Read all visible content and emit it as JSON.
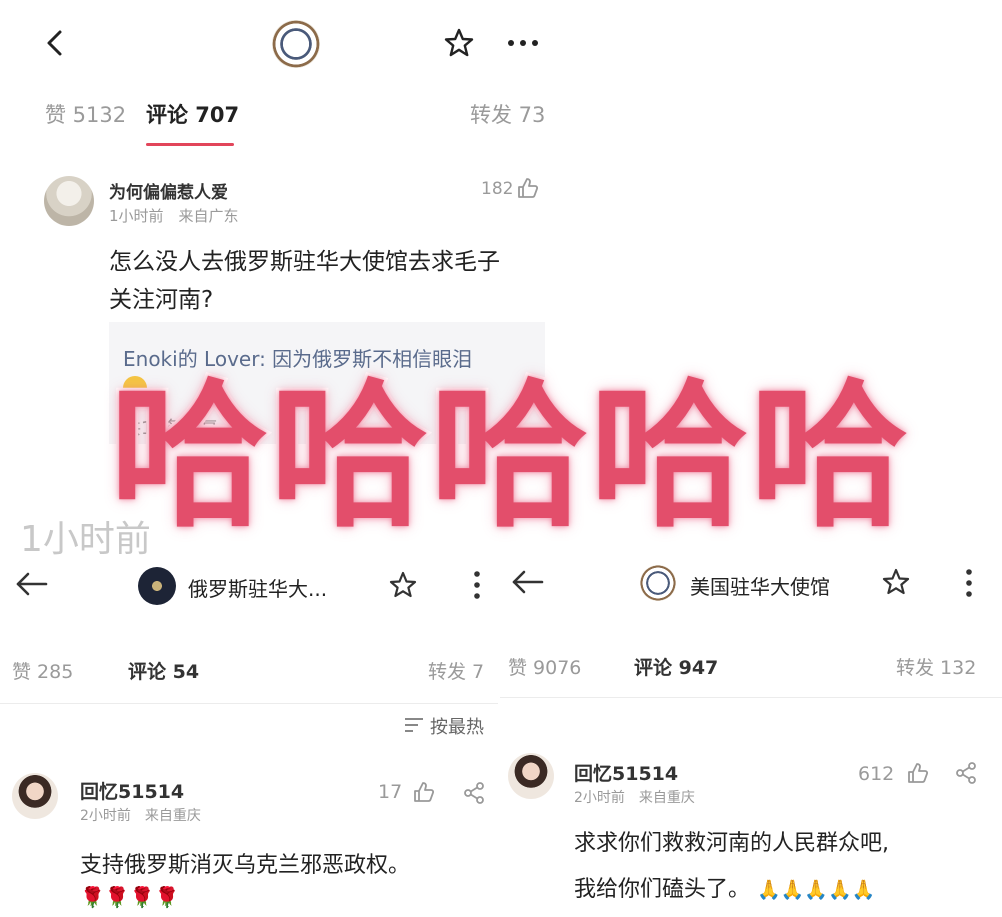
{
  "top": {
    "tabs": {
      "likes": "赞 5132",
      "comments": "评论 707",
      "reposts": "转发 73"
    },
    "comment": {
      "author": "为何偏偏惹人爱",
      "meta": "1小时前　来自广东",
      "like_count": "182",
      "text_line1": "怎么没人去俄罗斯驻华大使馆去求毛子",
      "text_line2": "关注河南?",
      "reply": "Enoki的 Lover: 因为俄罗斯不相信眼泪",
      "reply_footer_fragment": "共10条回复",
      "time_fragment": "1小时前"
    }
  },
  "overlay_text": "哈哈哈哈哈",
  "left": {
    "account_name": "俄罗斯驻华大...",
    "tabs": {
      "likes": "赞 285",
      "comments": "评论 54",
      "reposts": "转发 7"
    },
    "sort_label": "按最热",
    "comment": {
      "author": "回忆51514",
      "meta": "2小时前　来自重庆",
      "like_count": "17",
      "text": "支持俄罗斯消灭乌克兰邪恶政权。",
      "emoji": "🌹🌹🌹🌹"
    }
  },
  "right": {
    "account_name": "美国驻华大使馆",
    "tabs": {
      "likes": "赞 9076",
      "comments": "评论 947",
      "reposts": "转发 132"
    },
    "comment": {
      "author": "回忆51514",
      "meta": "2小时前　来自重庆",
      "like_count": "612",
      "text_line1": "求求你们救救河南的人民群众吧,",
      "text_line2": "我给你们磕头了。",
      "emoji": "🙏🙏🙏🙏🙏"
    }
  },
  "colors": {
    "accent": "#e2455a",
    "overlay": "#e34e6b"
  }
}
